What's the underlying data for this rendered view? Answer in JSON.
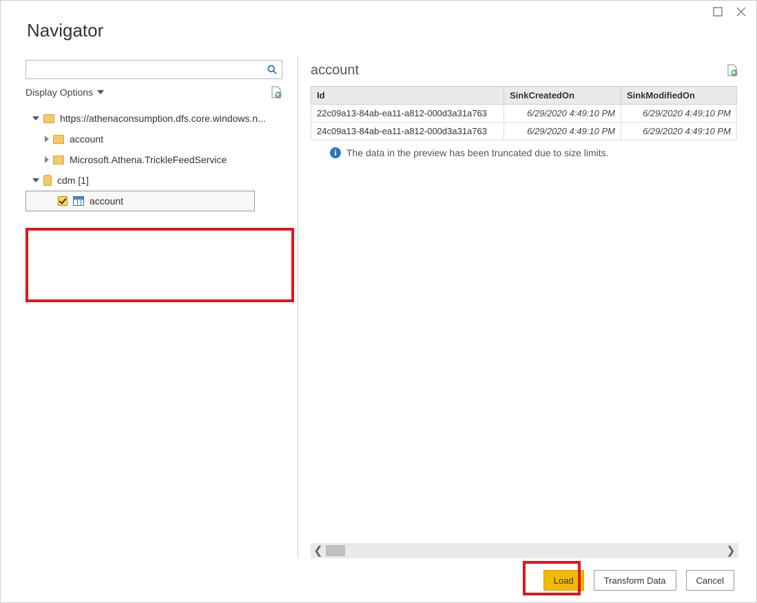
{
  "window": {
    "title": "Navigator"
  },
  "search": {
    "placeholder": ""
  },
  "display_options": {
    "label": "Display Options"
  },
  "tree": {
    "root": {
      "label": "https://athenaconsumption.dfs.core.windows.n..."
    },
    "folder_account": {
      "label": "account"
    },
    "folder_trickle": {
      "label": "Microsoft.Athena.TrickleFeedService"
    },
    "cdm": {
      "label": "cdm [1]"
    },
    "entity_account": {
      "label": "account"
    }
  },
  "preview": {
    "title": "account",
    "columns": {
      "id": "Id",
      "created": "SinkCreatedOn",
      "modified": "SinkModifiedOn"
    },
    "rows": [
      {
        "id": "22c09a13-84ab-ea11-a812-000d3a31a763",
        "created": "6/29/2020 4:49:10 PM",
        "modified": "6/29/2020 4:49:10 PM"
      },
      {
        "id": "24c09a13-84ab-ea11-a812-000d3a31a763",
        "created": "6/29/2020 4:49:10 PM",
        "modified": "6/29/2020 4:49:10 PM"
      }
    ],
    "info": "The data in the preview has been truncated due to size limits."
  },
  "footer": {
    "load": "Load",
    "transform": "Transform Data",
    "cancel": "Cancel"
  }
}
